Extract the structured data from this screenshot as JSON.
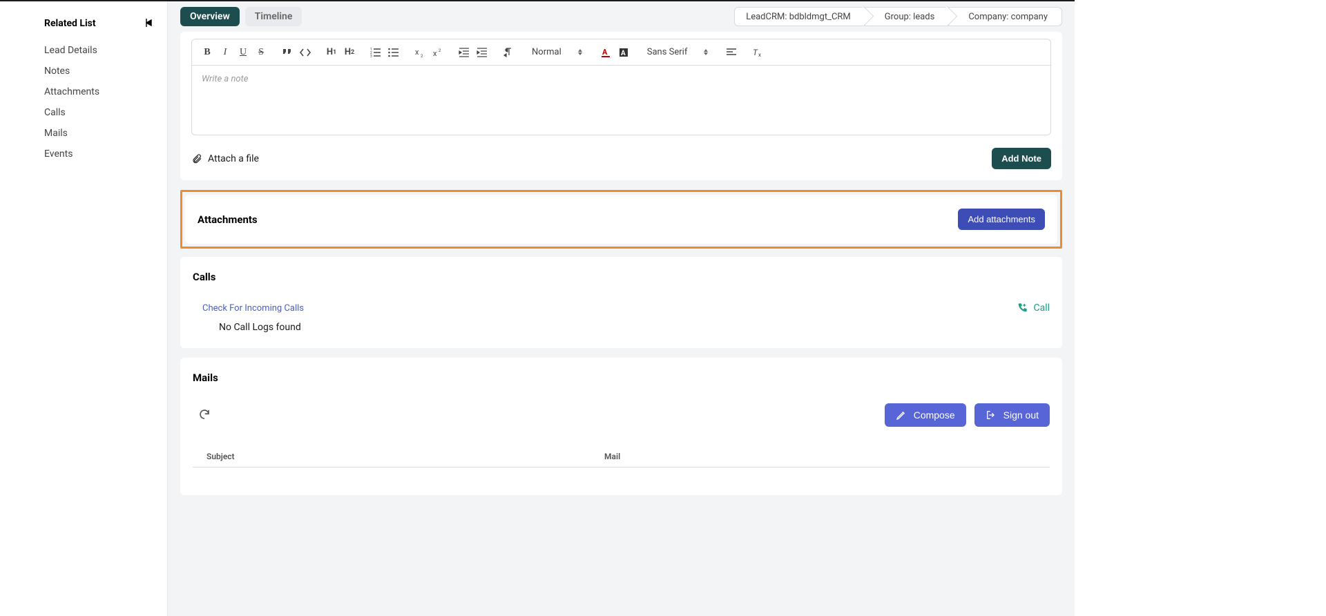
{
  "sidebar": {
    "title": "Related List",
    "items": [
      {
        "label": "Lead Details"
      },
      {
        "label": "Notes"
      },
      {
        "label": "Attachments"
      },
      {
        "label": "Calls"
      },
      {
        "label": "Mails"
      },
      {
        "label": "Events"
      }
    ]
  },
  "tabs": {
    "overview": "Overview",
    "timeline": "Timeline"
  },
  "breadcrumbs": {
    "crm": "LeadCRM: bdbldmgt_CRM",
    "group": "Group: leads",
    "company": "Company: company"
  },
  "notes": {
    "placeholder": "Write a note",
    "toolbar": {
      "normal": "Normal",
      "fontfamily": "Sans Serif"
    },
    "attach_file": "Attach a file",
    "add_note": "Add Note"
  },
  "attachments": {
    "title": "Attachments",
    "add_btn": "Add attachments"
  },
  "calls": {
    "title": "Calls",
    "check_link": "Check For Incoming Calls",
    "call_btn": "Call",
    "no_logs": "No Call Logs found"
  },
  "mails": {
    "title": "Mails",
    "compose": "Compose",
    "signout": "Sign out",
    "columns": {
      "subject": "Subject",
      "mail": "Mail"
    }
  }
}
